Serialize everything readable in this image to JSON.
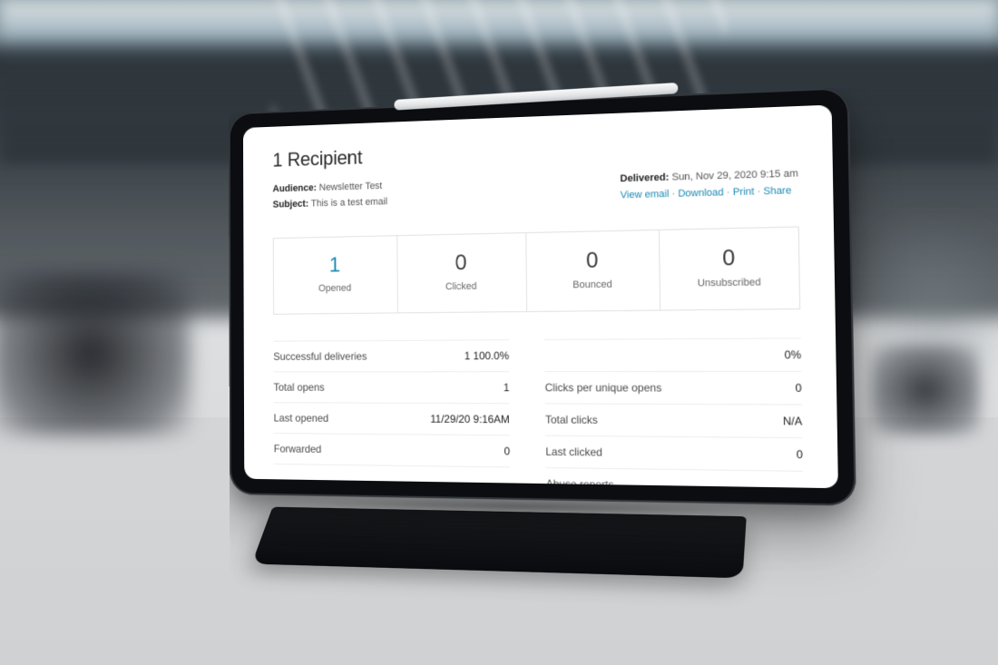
{
  "header": {
    "title": "1 Recipient"
  },
  "meta": {
    "audience_label": "Audience:",
    "audience_value": "Newsletter Test",
    "subject_label": "Subject:",
    "subject_value": "This is a test email",
    "delivered_label": "Delivered:",
    "delivered_value": "Sun, Nov 29, 2020 9:15 am"
  },
  "actions": {
    "view_email": "View email",
    "download": "Download",
    "print": "Print",
    "share": "Share"
  },
  "stats": [
    {
      "value": "1",
      "label": "Opened",
      "accent": true
    },
    {
      "value": "0",
      "label": "Clicked",
      "accent": false
    },
    {
      "value": "0",
      "label": "Bounced",
      "accent": false
    },
    {
      "value": "0",
      "label": "Unsubscribed",
      "accent": false
    }
  ],
  "details_left": [
    {
      "label": "Successful deliveries",
      "value": "1 100.0%"
    },
    {
      "label": "Total opens",
      "value": "1"
    },
    {
      "label": "Last opened",
      "value": "11/29/20 9:16AM"
    },
    {
      "label": "Forwarded",
      "value": "0"
    }
  ],
  "details_right": [
    {
      "label": "",
      "value": "0%"
    },
    {
      "label": "Clicks per unique opens",
      "value": "0"
    },
    {
      "label": "Total clicks",
      "value": "N/A"
    },
    {
      "label": "Last clicked",
      "value": "0"
    },
    {
      "label": "Abuse reports",
      "value": ""
    }
  ]
}
